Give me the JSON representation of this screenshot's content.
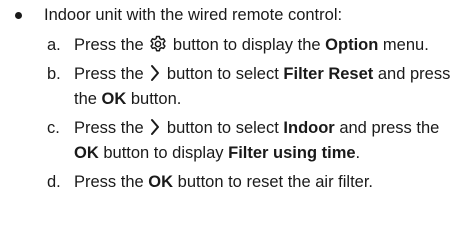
{
  "bullet": {
    "text": "Indoor unit with the wired remote control:"
  },
  "steps": [
    {
      "letter": "a.",
      "t1": "Press the",
      "icon": "gear-icon",
      "t2": "button to display the",
      "b1": "Option",
      "t3": "menu."
    },
    {
      "letter": "b.",
      "t1": "Press the",
      "icon": "chevron-right-icon",
      "t2": "button to select",
      "b1": "Filter Reset",
      "t3": "and press the",
      "b2": "OK",
      "t4": "button."
    },
    {
      "letter": "c.",
      "t1": "Press the",
      "icon": "chevron-right-icon",
      "t2": "button to select",
      "b1": "Indoor",
      "t3": "and press the",
      "b2": "OK",
      "t4": "button to display",
      "b3": "Filter using time",
      "t5": "."
    },
    {
      "letter": "d.",
      "t1": "Press the",
      "b1": "OK",
      "t2": "button to reset the air filter."
    }
  ]
}
